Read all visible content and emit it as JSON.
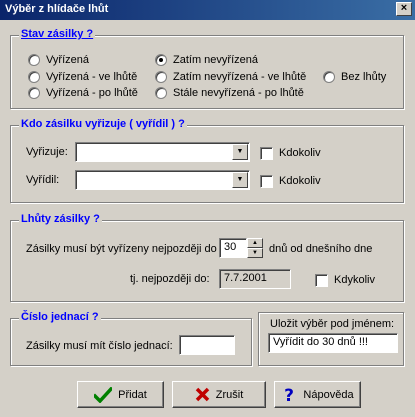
{
  "window": {
    "title": "Výběr z hlídače lhůt",
    "close_glyph": "×"
  },
  "stav": {
    "legend": "Stav zásilky ?",
    "options": [
      {
        "label": "Vyřízená",
        "checked": false
      },
      {
        "label": "Vyřízená - ve lhůtě",
        "checked": false
      },
      {
        "label": "Vyřízená - po lhůtě",
        "checked": false
      },
      {
        "label": "Zatím nevyřízená",
        "checked": true
      },
      {
        "label": "Zatím nevyřízená - ve lhůtě",
        "checked": false
      },
      {
        "label": "Stále nevyřízená - po lhůtě",
        "checked": false
      },
      {
        "label": "Bez lhůty",
        "checked": false
      }
    ]
  },
  "kdo": {
    "legend": "Kdo zásilku vyřizuje ( vyřídil ) ?",
    "vyrizuje_label": "Vyřizuje:",
    "vyrizuje_value": "",
    "vyridil_label": "Vyřídil:",
    "vyridil_value": "",
    "kdokoliv_label": "Kdokoliv",
    "combo_arrow": "▼"
  },
  "lhuty": {
    "legend": "Lhůty zásilky ?",
    "prefix": "Zásilky musí být vyřízeny nejpozději do",
    "days_value": "30",
    "suffix": "dnů od dnešního dne",
    "date_label": "tj. nejpozději do:",
    "date_value": "7.7.2001",
    "kdykoliv_label": "Kdykoliv",
    "spin_up": "▲",
    "spin_down": "▼"
  },
  "cislo": {
    "legend": "Číslo jednací ?",
    "label": "Zásilky musí mít číslo jednací:",
    "value": ""
  },
  "ulozit": {
    "label": "Uložit výběr pod jménem:",
    "value": "Vyřídit do 30 dnů !!!"
  },
  "buttons": {
    "pridat": "Přidat",
    "zrusit": "Zrušit",
    "napoveda": "Nápověda"
  },
  "colors": {
    "legend": "#0000ff",
    "face": "#d4d0c8",
    "title_bar": "#0a246a"
  }
}
